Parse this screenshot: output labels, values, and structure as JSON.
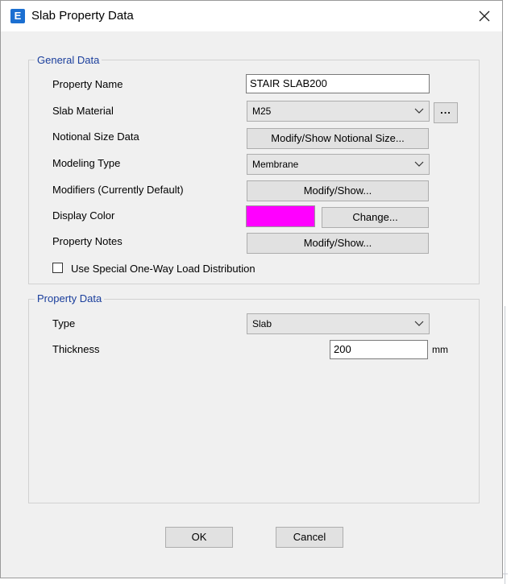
{
  "window": {
    "title": "Slab Property Data",
    "app_icon_letter": "E"
  },
  "general": {
    "title": "General Data",
    "property_name_label": "Property Name",
    "property_name_value": "STAIR SLAB200",
    "slab_material_label": "Slab Material",
    "slab_material_value": "M25",
    "material_more_label": "...",
    "notional_label": "Notional Size Data",
    "notional_button": "Modify/Show Notional Size...",
    "modeling_label": "Modeling Type",
    "modeling_value": "Membrane",
    "modifiers_label": "Modifiers (Currently Default)",
    "modifiers_button": "Modify/Show...",
    "display_color_label": "Display Color",
    "display_color": "#ff00ff",
    "change_button": "Change...",
    "notes_label": "Property Notes",
    "notes_button": "Modify/Show...",
    "one_way_label": "Use Special One-Way Load Distribution",
    "one_way_checked": false
  },
  "property": {
    "title": "Property Data",
    "type_label": "Type",
    "type_value": "Slab",
    "thickness_label": "Thickness",
    "thickness_value": "200",
    "thickness_unit": "mm"
  },
  "footer": {
    "ok_label": "OK",
    "cancel_label": "Cancel"
  }
}
